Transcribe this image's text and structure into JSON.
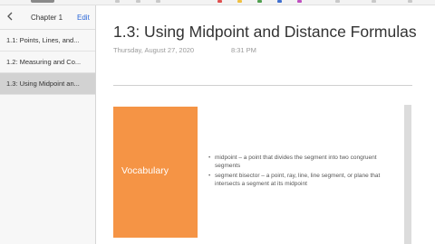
{
  "colors": {
    "accent": "#2a66d8",
    "vocab_box": "#f59445",
    "selected_item": "#d2d2d2"
  },
  "sidebar": {
    "back_icon": "chevron-left-icon",
    "section_title": "Chapter 1",
    "edit_label": "Edit",
    "pages": [
      {
        "label": "1.1:  Points, Lines, and..."
      },
      {
        "label": "1.2:  Measuring and Co..."
      },
      {
        "label": "1.3:  Using Midpoint an..."
      }
    ]
  },
  "page": {
    "title": "1.3:  Using Midpoint and Distance Formulas",
    "date": "Thursday, August 27, 2020",
    "time": "8:31 PM"
  },
  "vocab": {
    "title": "Vocabulary",
    "items": [
      "midpoint – a point that divides the segment into two congruent segments",
      "segment bisector – a point, ray, line, line segment, or plane that intersects a segment at its midpoint"
    ]
  }
}
